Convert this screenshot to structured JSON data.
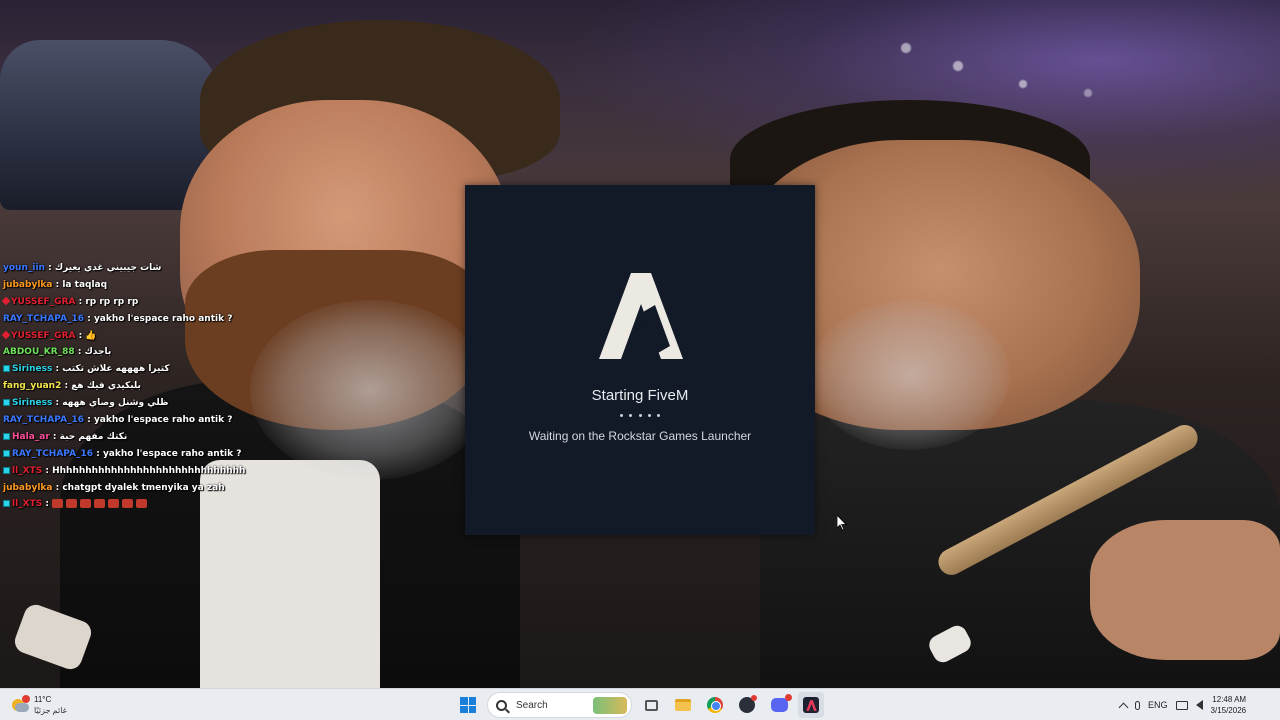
{
  "chat": {
    "lines": [
      {
        "user": "youn_iin",
        "user_color": "#3a78ff",
        "message": "شات جيبيني غدي يعيرك",
        "badge": ""
      },
      {
        "user": "jubabylka",
        "user_color": "#ff9a1f",
        "message": "la taqlaq",
        "badge": ""
      },
      {
        "user": "YUSSEF_GRA",
        "user_color": "#e02030",
        "message": "rp rp rp rp",
        "badge": "diamond"
      },
      {
        "user": "RAY_TCHAPA_16",
        "user_color": "#3a78ff",
        "message": "yakho l'espace raho antik ?",
        "badge": ""
      },
      {
        "user": "YUSSEF_GRA",
        "user_color": "#e02030",
        "message": "👍",
        "badge": "diamond"
      },
      {
        "user": "ABDOU_KR_88",
        "user_color": "#6ee05a",
        "message": "باجدك",
        "badge": ""
      },
      {
        "user": "Siriness",
        "user_color": "#2bd4e8",
        "message": "كتيرا ههههه علاش تكتب",
        "badge": "square"
      },
      {
        "user": "fang_yuan2",
        "user_color": "#f2e44c",
        "message": "بلبكيدي فيك هع",
        "badge": ""
      },
      {
        "user": "Siriness",
        "user_color": "#2bd4e8",
        "message": "ظلي وشنل وصاي هههه",
        "badge": "square"
      },
      {
        "user": "RAY_TCHAPA_16",
        "user_color": "#3a78ff",
        "message": "yakho l'espace raho antik ?",
        "badge": ""
      },
      {
        "user": "Hala_ar",
        "user_color": "#ff4f9a",
        "message": "نكتك مفهم حبة",
        "badge": "square"
      },
      {
        "user": "RAY_TCHAPA_16",
        "user_color": "#3a78ff",
        "message": "yakho l'espace raho antik ?",
        "badge": "square"
      },
      {
        "user": "ll_XTS",
        "user_color": "#e02030",
        "message": "Hhhhhhhhhhhhhhhhhhhhhhhhhhhhhh",
        "badge": "square"
      },
      {
        "user": "jubabylka",
        "user_color": "#ff9a1f",
        "message": "chatgpt dyalek tmenyika ya zah",
        "badge": ""
      },
      {
        "user": "ll_XTS",
        "user_color": "#e02030",
        "message": "",
        "badge": "square",
        "emojis": 7
      }
    ]
  },
  "dialog": {
    "title": "Starting FiveM",
    "status": "Waiting on the Rockstar Games Launcher"
  },
  "taskbar": {
    "weather_temp": "11°C",
    "weather_desc": "غائم جزئيًا",
    "search_label": "Search",
    "language": "ENG",
    "time": "12:48 AM",
    "date": "3/15/2026"
  }
}
